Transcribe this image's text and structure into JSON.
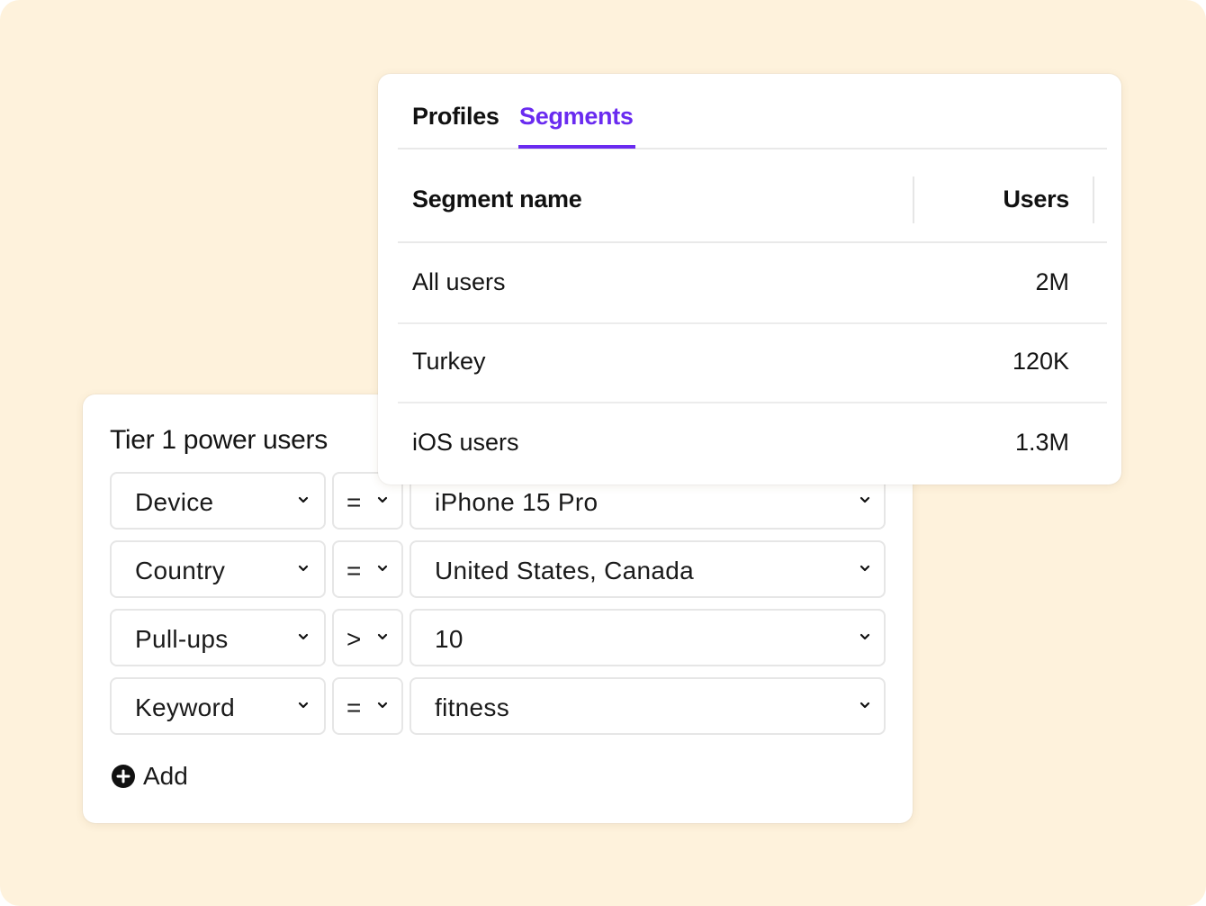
{
  "segments_panel": {
    "tabs": [
      {
        "label": "Profiles",
        "active": false
      },
      {
        "label": "Segments",
        "active": true
      }
    ],
    "accent_color": "#6a2bf0",
    "columns": [
      "Segment name",
      "Users"
    ],
    "rows": [
      {
        "name": "All users",
        "users": "2M"
      },
      {
        "name": "Turkey",
        "users": "120K"
      },
      {
        "name": "iOS users",
        "users": "1.3M"
      }
    ]
  },
  "filter_panel": {
    "title": "Tier 1 power users",
    "conditions": [
      {
        "field": "Device",
        "operator": "=",
        "value": "iPhone 15 Pro"
      },
      {
        "field": "Country",
        "operator": "=",
        "value": "United States, Canada"
      },
      {
        "field": "Pull-ups",
        "operator": ">",
        "value": "10"
      },
      {
        "field": "Keyword",
        "operator": "=",
        "value": "fitness"
      }
    ],
    "add_label": "Add",
    "add_icon": "plus-circle-icon",
    "dropdown_icon": "chevron-down-icon"
  }
}
